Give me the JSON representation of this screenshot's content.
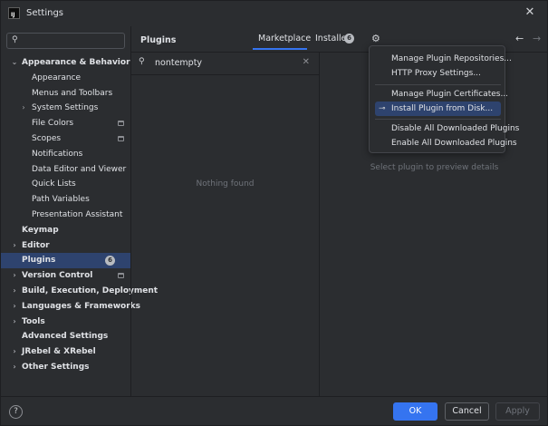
{
  "window": {
    "title": "Settings",
    "app_icon_text": "IJ"
  },
  "sidebar": {
    "search": {
      "value": "",
      "placeholder": ""
    },
    "items": [
      {
        "label": "Appearance & Behavior",
        "level": 0,
        "bold": true,
        "chevron": "expanded"
      },
      {
        "label": "Appearance",
        "level": 1
      },
      {
        "label": "Menus and Toolbars",
        "level": 1
      },
      {
        "label": "System Settings",
        "level": 1,
        "chevron": "collapsed"
      },
      {
        "label": "File Colors",
        "level": 1,
        "project_icon": true
      },
      {
        "label": "Scopes",
        "level": 1,
        "project_icon": true
      },
      {
        "label": "Notifications",
        "level": 1
      },
      {
        "label": "Data Editor and Viewer",
        "level": 1
      },
      {
        "label": "Quick Lists",
        "level": 1
      },
      {
        "label": "Path Variables",
        "level": 1
      },
      {
        "label": "Presentation Assistant",
        "level": 1
      },
      {
        "label": "Keymap",
        "level": 0,
        "bold": true
      },
      {
        "label": "Editor",
        "level": 0,
        "bold": true,
        "chevron": "collapsed"
      },
      {
        "label": "Plugins",
        "level": 0,
        "bold": true,
        "selected": true,
        "badge": "6"
      },
      {
        "label": "Version Control",
        "level": 0,
        "bold": true,
        "chevron": "collapsed",
        "project_icon": true
      },
      {
        "label": "Build, Execution, Deployment",
        "level": 0,
        "bold": true,
        "chevron": "collapsed"
      },
      {
        "label": "Languages & Frameworks",
        "level": 0,
        "bold": true,
        "chevron": "collapsed"
      },
      {
        "label": "Tools",
        "level": 0,
        "bold": true,
        "chevron": "collapsed"
      },
      {
        "label": "Advanced Settings",
        "level": 0,
        "bold": true
      },
      {
        "label": "JRebel & XRebel",
        "level": 0,
        "bold": true,
        "chevron": "collapsed"
      },
      {
        "label": "Other Settings",
        "level": 0,
        "bold": true,
        "chevron": "collapsed"
      }
    ]
  },
  "main": {
    "title": "Plugins",
    "tabs": [
      {
        "label": "Marketplace",
        "active": true
      },
      {
        "label": "Installed",
        "badge": "6"
      }
    ],
    "plugin_search": {
      "value": "nontempty"
    },
    "empty_text": "Nothing found",
    "preview_hint": "Select plugin to preview details"
  },
  "gear_menu": {
    "items": [
      {
        "label": "Manage Plugin Repositories..."
      },
      {
        "label": "HTTP Proxy Settings..."
      },
      {
        "label": "Manage Plugin Certificates..."
      },
      {
        "label": "Install Plugin from Disk...",
        "highlighted": true,
        "icon": "plug-icon"
      },
      {
        "label": "Disable All Downloaded Plugins"
      },
      {
        "label": "Enable All Downloaded Plugins"
      }
    ]
  },
  "footer": {
    "help": "?",
    "ok": "OK",
    "cancel": "Cancel",
    "apply": "Apply"
  },
  "colors": {
    "background": "#2b2d30",
    "selection": "#2e436e",
    "accent": "#3574f0",
    "text": "#dfe1e5",
    "muted_text": "#6f737a"
  }
}
